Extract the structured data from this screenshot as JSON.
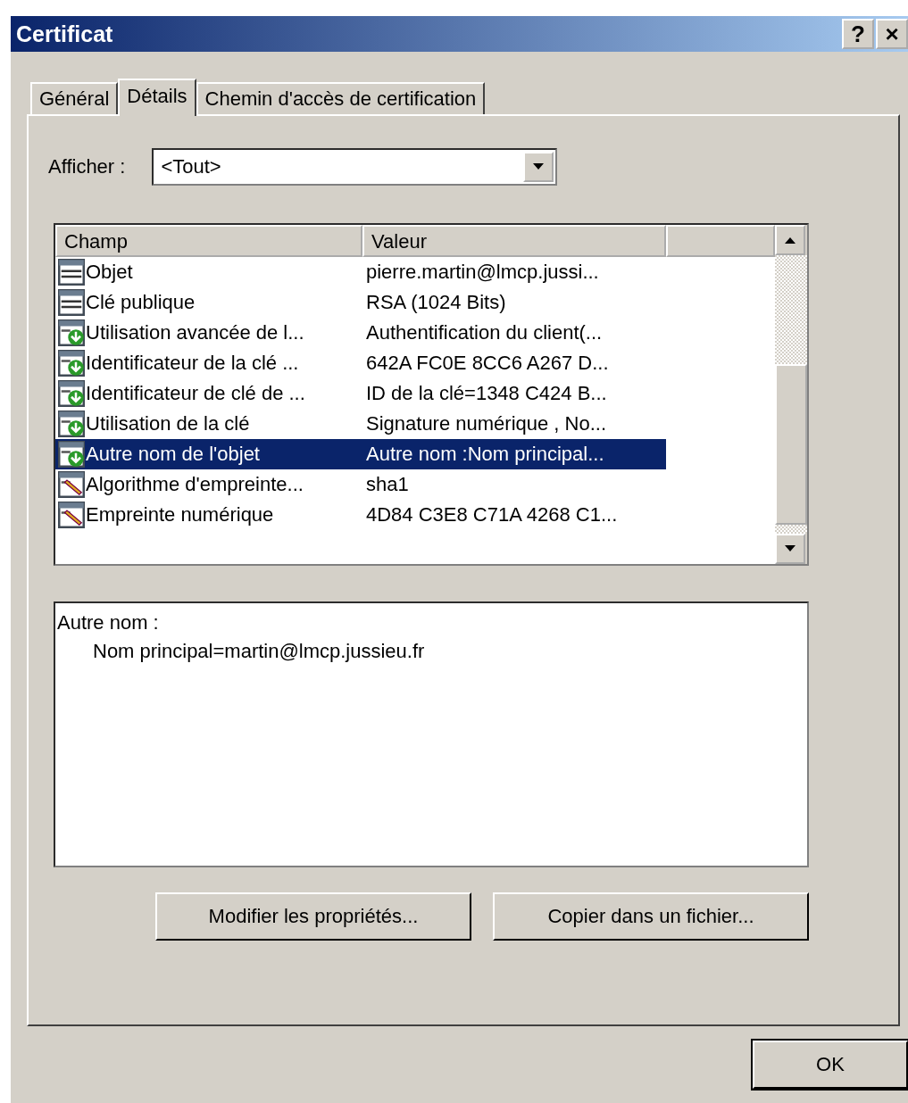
{
  "window": {
    "title": "Certificat",
    "help_button": "?",
    "close_button": "×"
  },
  "tabs": [
    {
      "label": "Général",
      "selected": false
    },
    {
      "label": "Détails",
      "selected": true
    },
    {
      "label": "Chemin d'accès de certification",
      "selected": false
    }
  ],
  "show": {
    "label": "Afficher :",
    "value": "<Tout>"
  },
  "table": {
    "columns": [
      "Champ",
      "Valeur"
    ],
    "rows": [
      {
        "kind": "field",
        "field": "Objet",
        "value": "pierre.martin@lmcp.jussi...",
        "selected": false
      },
      {
        "kind": "field",
        "field": "Clé publique",
        "value": "RSA (1024 Bits)",
        "selected": false
      },
      {
        "kind": "extension",
        "field": "Utilisation avancée de l...",
        "value": "Authentification du client(...",
        "selected": false
      },
      {
        "kind": "extension",
        "field": "Identificateur de la clé ...",
        "value": "642A FC0E 8CC6 A267 D...",
        "selected": false
      },
      {
        "kind": "extension",
        "field": "Identificateur de clé de ...",
        "value": "ID de la clé=1348 C424 B...",
        "selected": false
      },
      {
        "kind": "extension",
        "field": "Utilisation de la clé",
        "value": "Signature numérique , No...",
        "selected": false
      },
      {
        "kind": "extension",
        "field": "Autre nom de l'objet",
        "value": "Autre nom :Nom principal...",
        "selected": true
      },
      {
        "kind": "property",
        "field": "Algorithme d'empreinte...",
        "value": "sha1",
        "selected": false
      },
      {
        "kind": "property",
        "field": "Empreinte numérique",
        "value": "4D84 C3E8 C71A 4268 C1...",
        "selected": false
      }
    ]
  },
  "detail": [
    "Autre nom :",
    "Nom principal=martin@lmcp.jussieu.fr"
  ],
  "buttons": [
    "Modifier les propriétés...",
    "Copier dans un fichier..."
  ],
  "ok_button": "OK"
}
